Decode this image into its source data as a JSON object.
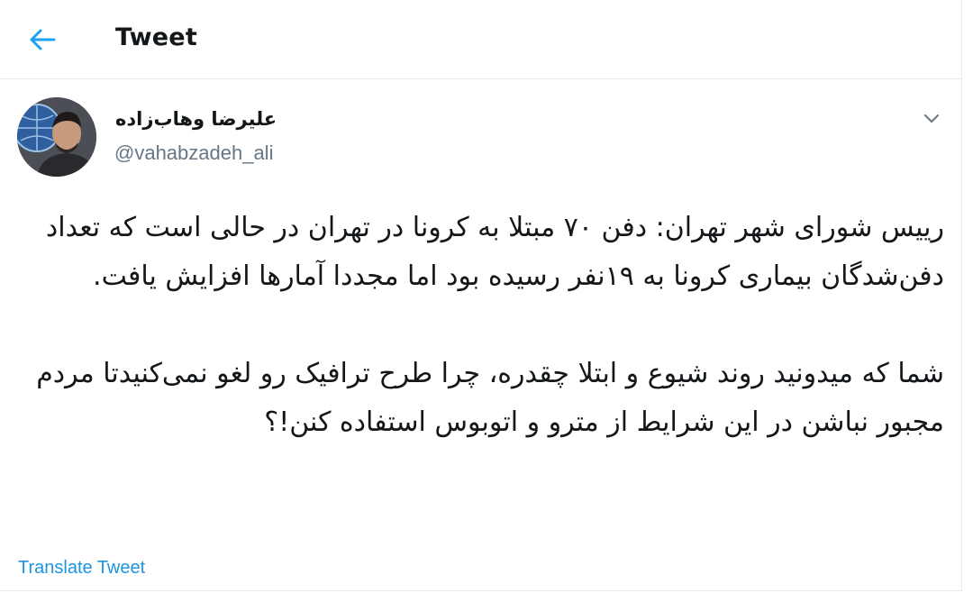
{
  "header": {
    "title": "Tweet"
  },
  "author": {
    "name": "علیرضا وهاب‌زاده",
    "handle": "@vahabzadeh_ali"
  },
  "tweet": {
    "paragraph1": "رییس شورای شهر تهران: دفن ۷۰ مبتلا به کرونا در تهران در حالی است که تعداد دفن‌شدگان بیماری کرونا به ۱۹نفر رسیده بود اما مجددا آمارها افزایش یافت.",
    "paragraph2": "شما که میدونید روند شیوع و ابتلا چقدره، چرا طرح ترافیک رو لغو نمی‌کنیدتا مردم مجبور نباشن در این شرایط از مترو و اتوبوس استفاده کنن!؟"
  },
  "actions": {
    "translate_label": "Translate Tweet"
  },
  "colors": {
    "accent": "#1da1f2",
    "link": "#1b95e0",
    "secondary_text": "#657786",
    "primary_text": "#14171a"
  },
  "icons": {
    "back": "arrow-left-icon",
    "more": "chevron-down-icon"
  }
}
